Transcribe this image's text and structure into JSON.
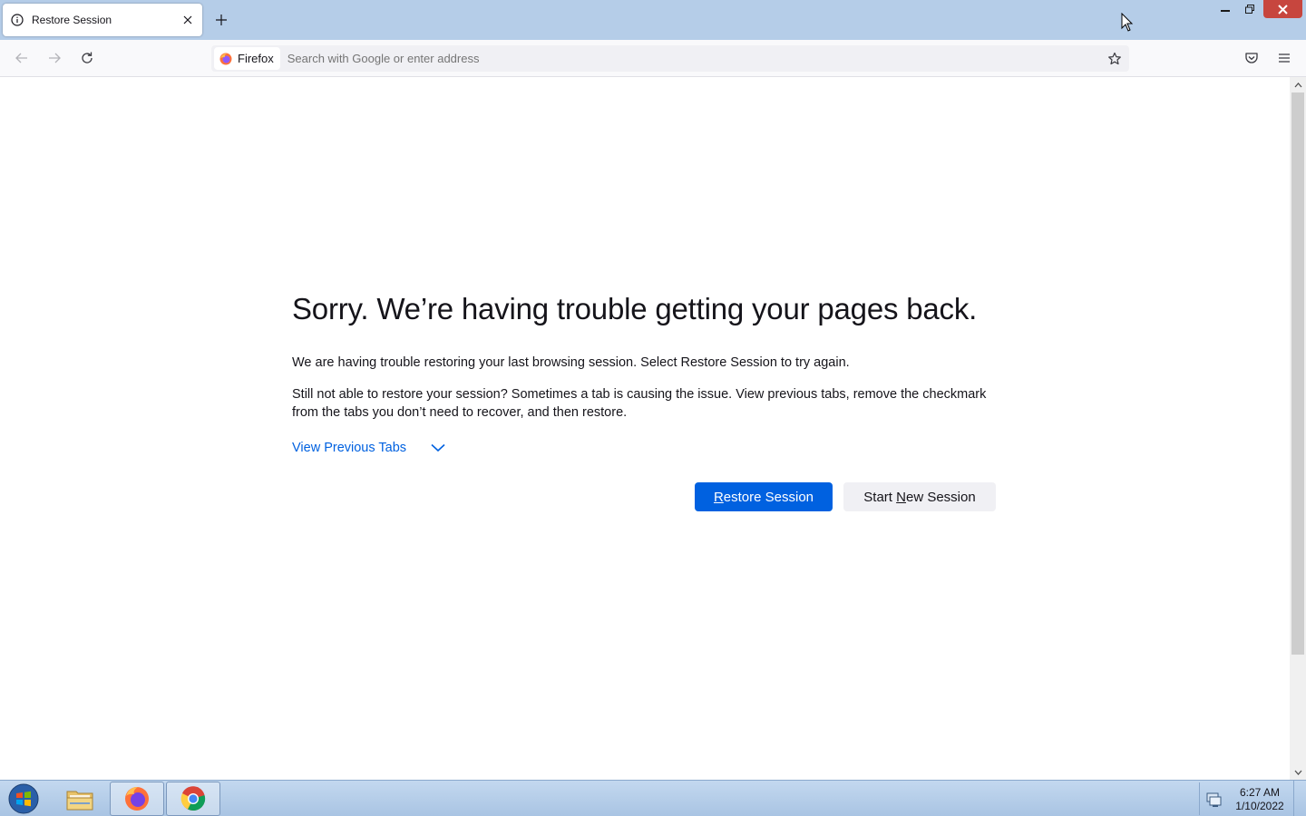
{
  "browser": {
    "tab": {
      "title": "Restore Session",
      "icon": "info-icon"
    },
    "new_tab_icon": "plus-icon",
    "window_controls": [
      "minimize-icon",
      "restore-icon",
      "close-icon"
    ]
  },
  "toolbar": {
    "identity_label": "Firefox",
    "url_placeholder": "Search with Google or enter address",
    "icons": [
      "back-arrow-icon",
      "forward-arrow-icon",
      "reload-icon",
      "star-icon",
      "pocket-icon",
      "hamburger-menu-icon"
    ]
  },
  "page": {
    "title": "Sorry. We’re having trouble getting your pages back.",
    "paragraph1": "We are having trouble restoring your last browsing session. Select Restore Session to try again.",
    "paragraph2": "Still not able to restore your session? Sometimes a tab is causing the issue. View previous tabs, remove the checkmark from the tabs you don’t need to recover, and then restore.",
    "view_previous_tabs": "View Previous Tabs",
    "restore_button": {
      "accesskey": "R",
      "rest": "estore Session"
    },
    "new_session_button": {
      "before": "Start ",
      "accesskey": "N",
      "rest": "ew Session"
    }
  },
  "taskbar": {
    "apps": [
      "windows-start-icon",
      "file-explorer-icon",
      "firefox-icon",
      "chrome-icon"
    ],
    "time": "6:27 AM",
    "date": "1/10/2022"
  },
  "colors": {
    "accent": "#0061e0",
    "titlebar": "#b5cde8",
    "close_button": "#c7463e"
  }
}
